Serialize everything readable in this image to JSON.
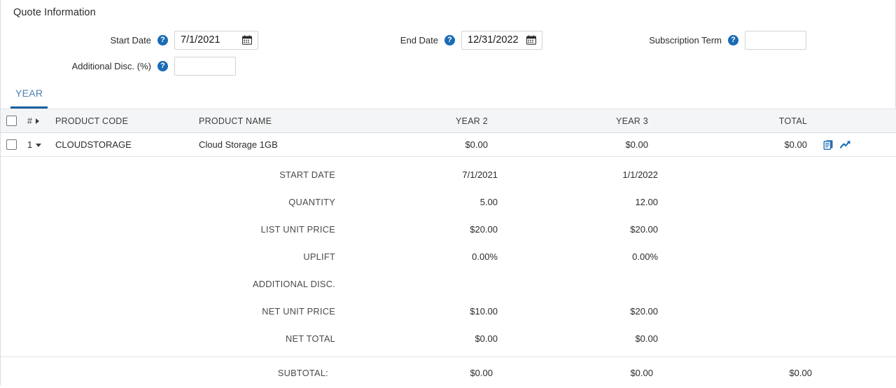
{
  "section": {
    "title": "Quote Information"
  },
  "form": {
    "fields": [
      {
        "label": "Start Date",
        "value": "7/1/2021",
        "placeholder": "",
        "has_calendar": true,
        "help_icon": "help-circle-icon"
      },
      {
        "label": "End Date",
        "value": "12/31/2022",
        "placeholder": "",
        "has_calendar": true,
        "help_icon": "help-circle-icon"
      },
      {
        "label": "Subscription Term",
        "value": "",
        "placeholder": "",
        "has_calendar": false,
        "help_icon": "help-circle-icon"
      },
      {
        "label": "Additional Disc. (%)",
        "value": "",
        "placeholder": "",
        "has_calendar": false,
        "help_icon": "help-circle-icon"
      }
    ]
  },
  "tabs": {
    "items": [
      {
        "label": "YEAR",
        "selected": true
      }
    ]
  },
  "table": {
    "headers": {
      "num": "#",
      "product_code": "PRODUCT CODE",
      "product_name": "PRODUCT NAME",
      "year2": "YEAR 2",
      "year3": "YEAR 3",
      "total": "TOTAL"
    },
    "rows": [
      {
        "num": "1",
        "product_code": "CLOUDSTORAGE",
        "product_name": "Cloud Storage 1GB",
        "year2": "$0.00",
        "year3": "$0.00",
        "total": "$0.00",
        "icons": [
          "document-copy-icon",
          "trend-arrow-icon"
        ]
      }
    ],
    "details": [
      {
        "label": "START DATE",
        "year2": "7/1/2021",
        "year3": "1/1/2022"
      },
      {
        "label": "QUANTITY",
        "year2": "5.00",
        "year3": "12.00"
      },
      {
        "label": "LIST UNIT PRICE",
        "year2": "$20.00",
        "year3": "$20.00"
      },
      {
        "label": "UPLIFT",
        "year2": "0.00%",
        "year3": "0.00%"
      },
      {
        "label": "ADDITIONAL DISC.",
        "year2": "",
        "year3": ""
      },
      {
        "label": "NET UNIT PRICE",
        "year2": "$10.00",
        "year3": "$20.00"
      },
      {
        "label": "NET TOTAL",
        "year2": "$0.00",
        "year3": "$0.00"
      }
    ],
    "subtotal": {
      "label": "SUBTOTAL:",
      "year2": "$0.00",
      "year3": "$0.00",
      "total": "$0.00"
    }
  },
  "colors": {
    "accent_blue": "#1a6bb5",
    "tab_text": "#4a80b4",
    "tab_underline": "#1b5f9e",
    "header_bg": "#f4f5f6",
    "border": "#d8dde6"
  }
}
